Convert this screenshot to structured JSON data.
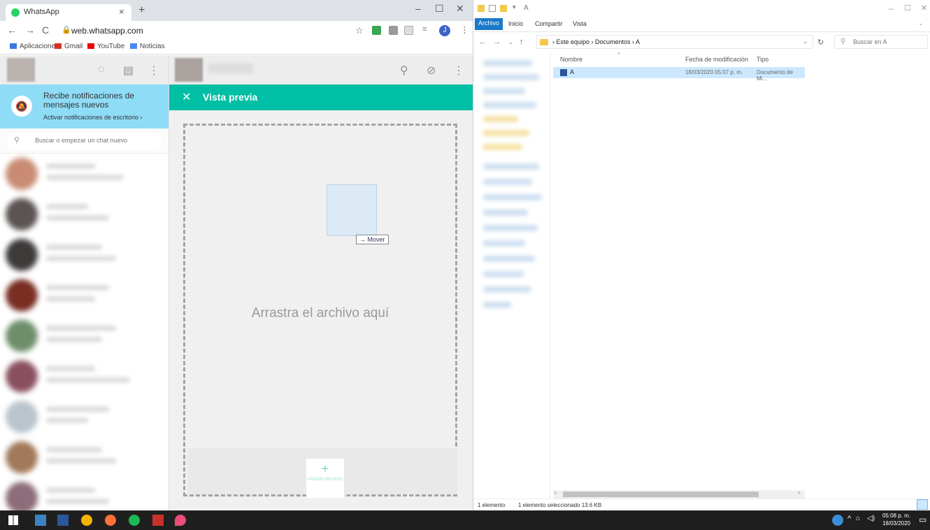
{
  "browser": {
    "tab_title": "WhatsApp",
    "url": "web.whatsapp.com",
    "profile_initial": "J",
    "bookmarks": [
      "Aplicaciones",
      "Gmail",
      "YouTube",
      "Noticias"
    ]
  },
  "whatsapp": {
    "notification": {
      "title": "Recibe notificaciones de mensajes nuevos",
      "link": "Activar notificaciones de escritorio ›"
    },
    "search_placeholder": "Buscar o empezar un chat nuevo",
    "preview": {
      "title": "Vista previa",
      "drop_text": "Arrastra el archivo aquí",
      "move_tooltip": "→ Mover",
      "add_file_label": "AÑADIR ARCHIVO"
    },
    "colors": {
      "teal": "#00bfa5",
      "notification": "#8fdcf7"
    }
  },
  "explorer": {
    "window_title": "A",
    "ribbon_tabs": [
      "Archivo",
      "Inicio",
      "Compartir",
      "Vista"
    ],
    "breadcrumb": "› Este equipo › Documentos › A",
    "search_placeholder": "Buscar en A",
    "columns": [
      "Nombre",
      "Fecha de modificación",
      "Tipo"
    ],
    "files": [
      {
        "name": "A",
        "modified": "18/03/2020 05:07 p. m.",
        "type": "Documento de Mi..."
      }
    ],
    "status_count": "1 elemento",
    "status_selection": "1 elemento seleccionado 13.6 KB"
  },
  "taskbar": {
    "time": "05:08 p. m.",
    "date": "18/03/2020"
  }
}
